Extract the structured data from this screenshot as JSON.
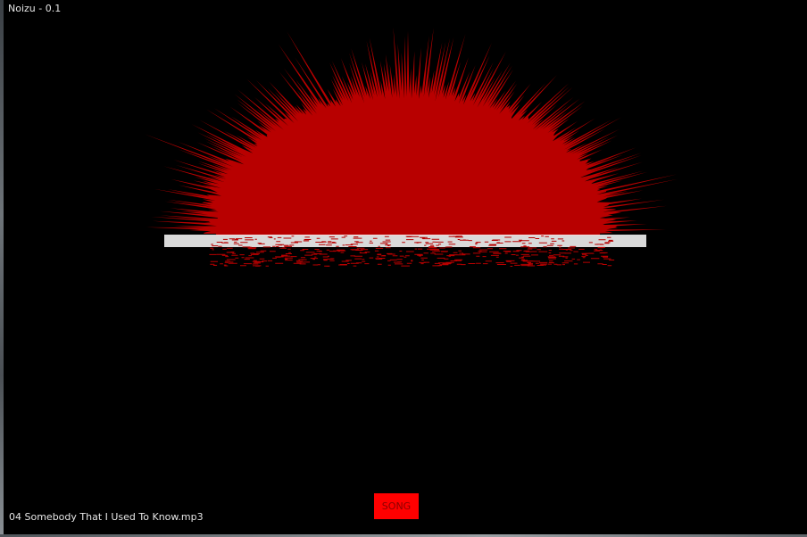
{
  "app": {
    "title": "Noizu - 0.1"
  },
  "player": {
    "track_name": "04 Somebody That I Used To Know.mp3",
    "song_button_label": "SONG"
  },
  "colors": {
    "background": "#000000",
    "burst": "#b80000",
    "particles": "#dffff4",
    "song_button": "#ff0000",
    "song_button_text": "#8a0000",
    "label_text": "#e6e6e6"
  }
}
